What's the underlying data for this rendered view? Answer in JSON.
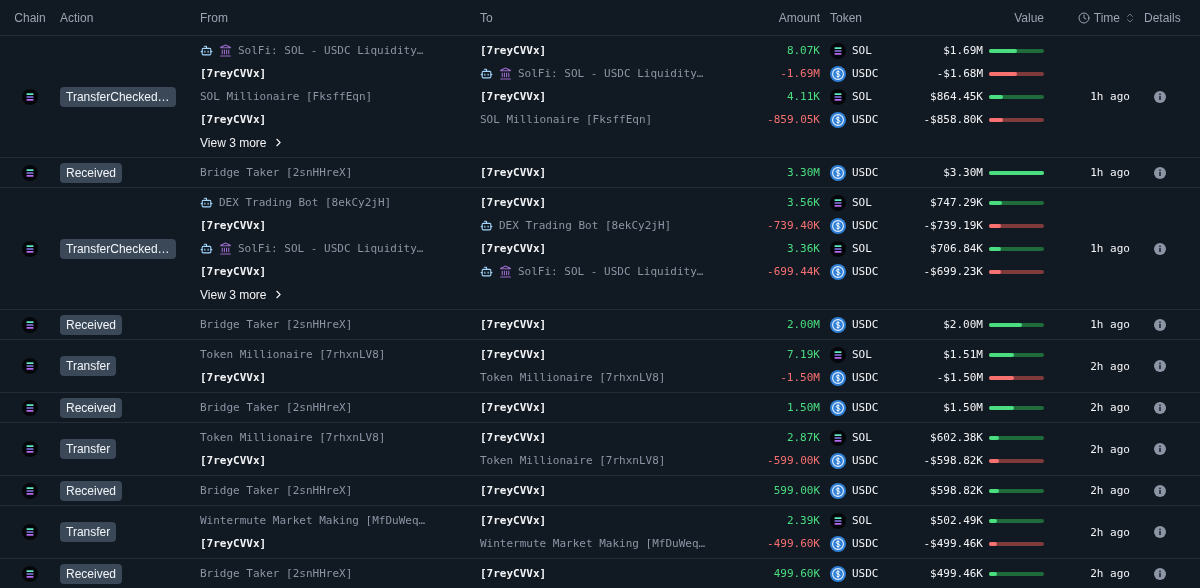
{
  "columns": [
    {
      "label": "Chain"
    },
    {
      "label": "Action"
    },
    {
      "label": "From"
    },
    {
      "label": "To"
    },
    {
      "label": "Amount"
    },
    {
      "label": "Token"
    },
    {
      "label": "Value"
    },
    {
      "label": "Time",
      "sortable": true
    },
    {
      "label": "Details"
    }
  ],
  "rows": [
    {
      "action": "TransferChecked…",
      "time": "1h ago",
      "more": "View 3 more",
      "lines": [
        {
          "from": {
            "kind": "label",
            "tags": [
              {
                "kind": "bot"
              },
              {
                "kind": "protocol"
              }
            ],
            "name": "SolFi: SOL - USDC Liquidity…"
          },
          "to": {
            "kind": "address",
            "name": "[7reyCVVx]"
          },
          "amount": "8.07K",
          "outgoing": false,
          "token": {
            "kind": "sol",
            "symbol": "SOL"
          },
          "value": "$1.69M",
          "level": 0.51
        },
        {
          "from": {
            "kind": "address",
            "name": "[7reyCVVx]"
          },
          "to": {
            "kind": "label",
            "tags": [
              {
                "kind": "bot"
              },
              {
                "kind": "protocol"
              }
            ],
            "name": "SolFi: SOL - USDC Liquidity…"
          },
          "amount": "-1.69M",
          "outgoing": true,
          "token": {
            "kind": "usdc",
            "symbol": "USDC"
          },
          "value": "-$1.68M",
          "level": 0.51
        },
        {
          "from": {
            "kind": "label",
            "name": "SOL Millionaire [FksffEqn]"
          },
          "to": {
            "kind": "address",
            "name": "[7reyCVVx]"
          },
          "amount": "4.11K",
          "outgoing": false,
          "token": {
            "kind": "sol",
            "symbol": "SOL"
          },
          "value": "$864.45K",
          "level": 0.26
        },
        {
          "from": {
            "kind": "address",
            "name": "[7reyCVVx]"
          },
          "to": {
            "kind": "label",
            "name": "SOL Millionaire [FksffEqn]"
          },
          "amount": "-859.05K",
          "outgoing": true,
          "token": {
            "kind": "usdc",
            "symbol": "USDC"
          },
          "value": "-$858.80K",
          "level": 0.26
        }
      ]
    },
    {
      "action": "Received",
      "time": "1h ago",
      "lines": [
        {
          "from": {
            "kind": "label",
            "name": "Bridge Taker [2snHHreX]"
          },
          "to": {
            "kind": "address",
            "name": "[7reyCVVx]"
          },
          "amount": "3.30M",
          "outgoing": false,
          "token": {
            "kind": "usdc",
            "symbol": "USDC"
          },
          "value": "$3.30M",
          "level": 1
        }
      ]
    },
    {
      "action": "TransferChecked…",
      "time": "1h ago",
      "more": "View 3 more",
      "lines": [
        {
          "from": {
            "kind": "label",
            "tags": [
              {
                "kind": "bot"
              }
            ],
            "name": "DEX Trading Bot [8ekCy2jH]"
          },
          "to": {
            "kind": "address",
            "name": "[7reyCVVx]"
          },
          "amount": "3.56K",
          "outgoing": false,
          "token": {
            "kind": "sol",
            "symbol": "SOL"
          },
          "value": "$747.29K",
          "level": 0.23
        },
        {
          "from": {
            "kind": "address",
            "name": "[7reyCVVx]"
          },
          "to": {
            "kind": "label",
            "tags": [
              {
                "kind": "bot"
              }
            ],
            "name": "DEX Trading Bot [8ekCy2jH]"
          },
          "amount": "-739.40K",
          "outgoing": true,
          "token": {
            "kind": "usdc",
            "symbol": "USDC"
          },
          "value": "-$739.19K",
          "level": 0.22
        },
        {
          "from": {
            "kind": "label",
            "tags": [
              {
                "kind": "bot"
              },
              {
                "kind": "protocol"
              }
            ],
            "name": "SolFi: SOL - USDC Liquidity…"
          },
          "to": {
            "kind": "address",
            "name": "[7reyCVVx]"
          },
          "amount": "3.36K",
          "outgoing": false,
          "token": {
            "kind": "sol",
            "symbol": "SOL"
          },
          "value": "$706.84K",
          "level": 0.21
        },
        {
          "from": {
            "kind": "address",
            "name": "[7reyCVVx]"
          },
          "to": {
            "kind": "label",
            "tags": [
              {
                "kind": "bot"
              },
              {
                "kind": "protocol"
              }
            ],
            "name": "SolFi: SOL - USDC Liquidity…"
          },
          "amount": "-699.44K",
          "outgoing": true,
          "token": {
            "kind": "usdc",
            "symbol": "USDC"
          },
          "value": "-$699.23K",
          "level": 0.21
        }
      ]
    },
    {
      "action": "Received",
      "time": "1h ago",
      "lines": [
        {
          "from": {
            "kind": "label",
            "name": "Bridge Taker [2snHHreX]"
          },
          "to": {
            "kind": "address",
            "name": "[7reyCVVx]"
          },
          "amount": "2.00M",
          "outgoing": false,
          "token": {
            "kind": "usdc",
            "symbol": "USDC"
          },
          "value": "$2.00M",
          "level": 0.6
        }
      ]
    },
    {
      "action": "Transfer",
      "time": "2h ago",
      "lines": [
        {
          "from": {
            "kind": "label",
            "name": "Token Millionaire [7rhxnLV8]"
          },
          "to": {
            "kind": "address",
            "name": "[7reyCVVx]"
          },
          "amount": "7.19K",
          "outgoing": false,
          "token": {
            "kind": "sol",
            "symbol": "SOL"
          },
          "value": "$1.51M",
          "level": 0.46
        },
        {
          "from": {
            "kind": "address",
            "name": "[7reyCVVx]"
          },
          "to": {
            "kind": "label",
            "name": "Token Millionaire [7rhxnLV8]"
          },
          "amount": "-1.50M",
          "outgoing": true,
          "token": {
            "kind": "usdc",
            "symbol": "USDC"
          },
          "value": "-$1.50M",
          "level": 0.45
        }
      ]
    },
    {
      "action": "Received",
      "time": "2h ago",
      "lines": [
        {
          "from": {
            "kind": "label",
            "name": "Bridge Taker [2snHHreX]"
          },
          "to": {
            "kind": "address",
            "name": "[7reyCVVx]"
          },
          "amount": "1.50M",
          "outgoing": false,
          "token": {
            "kind": "usdc",
            "symbol": "USDC"
          },
          "value": "$1.50M",
          "level": 0.45
        }
      ]
    },
    {
      "action": "Transfer",
      "time": "2h ago",
      "lines": [
        {
          "from": {
            "kind": "label",
            "name": "Token Millionaire [7rhxnLV8]"
          },
          "to": {
            "kind": "address",
            "name": "[7reyCVVx]"
          },
          "amount": "2.87K",
          "outgoing": false,
          "token": {
            "kind": "sol",
            "symbol": "SOL"
          },
          "value": "$602.38K",
          "level": 0.18
        },
        {
          "from": {
            "kind": "address",
            "name": "[7reyCVVx]"
          },
          "to": {
            "kind": "label",
            "name": "Token Millionaire [7rhxnLV8]"
          },
          "amount": "-599.00K",
          "outgoing": true,
          "token": {
            "kind": "usdc",
            "symbol": "USDC"
          },
          "value": "-$598.82K",
          "level": 0.18
        }
      ]
    },
    {
      "action": "Received",
      "time": "2h ago",
      "lines": [
        {
          "from": {
            "kind": "label",
            "name": "Bridge Taker [2snHHreX]"
          },
          "to": {
            "kind": "address",
            "name": "[7reyCVVx]"
          },
          "amount": "599.00K",
          "outgoing": false,
          "token": {
            "kind": "usdc",
            "symbol": "USDC"
          },
          "value": "$598.82K",
          "level": 0.18
        }
      ]
    },
    {
      "action": "Transfer",
      "time": "2h ago",
      "lines": [
        {
          "from": {
            "kind": "label",
            "name": "Wintermute Market Making [MfDuWeq…"
          },
          "to": {
            "kind": "address",
            "name": "[7reyCVVx]"
          },
          "amount": "2.39K",
          "outgoing": false,
          "token": {
            "kind": "sol",
            "symbol": "SOL"
          },
          "value": "$502.49K",
          "level": 0.15
        },
        {
          "from": {
            "kind": "address",
            "name": "[7reyCVVx]"
          },
          "to": {
            "kind": "label",
            "name": "Wintermute Market Making [MfDuWeq…"
          },
          "amount": "-499.60K",
          "outgoing": true,
          "token": {
            "kind": "usdc",
            "symbol": "USDC"
          },
          "value": "-$499.46K",
          "level": 0.15
        }
      ]
    },
    {
      "action": "Received",
      "time": "2h ago",
      "lines": [
        {
          "from": {
            "kind": "label",
            "name": "Bridge Taker [2snHHreX]"
          },
          "to": {
            "kind": "address",
            "name": "[7reyCVVx]"
          },
          "amount": "499.60K",
          "outgoing": false,
          "token": {
            "kind": "usdc",
            "symbol": "USDC"
          },
          "value": "$499.46K",
          "level": 0.15
        }
      ]
    }
  ]
}
